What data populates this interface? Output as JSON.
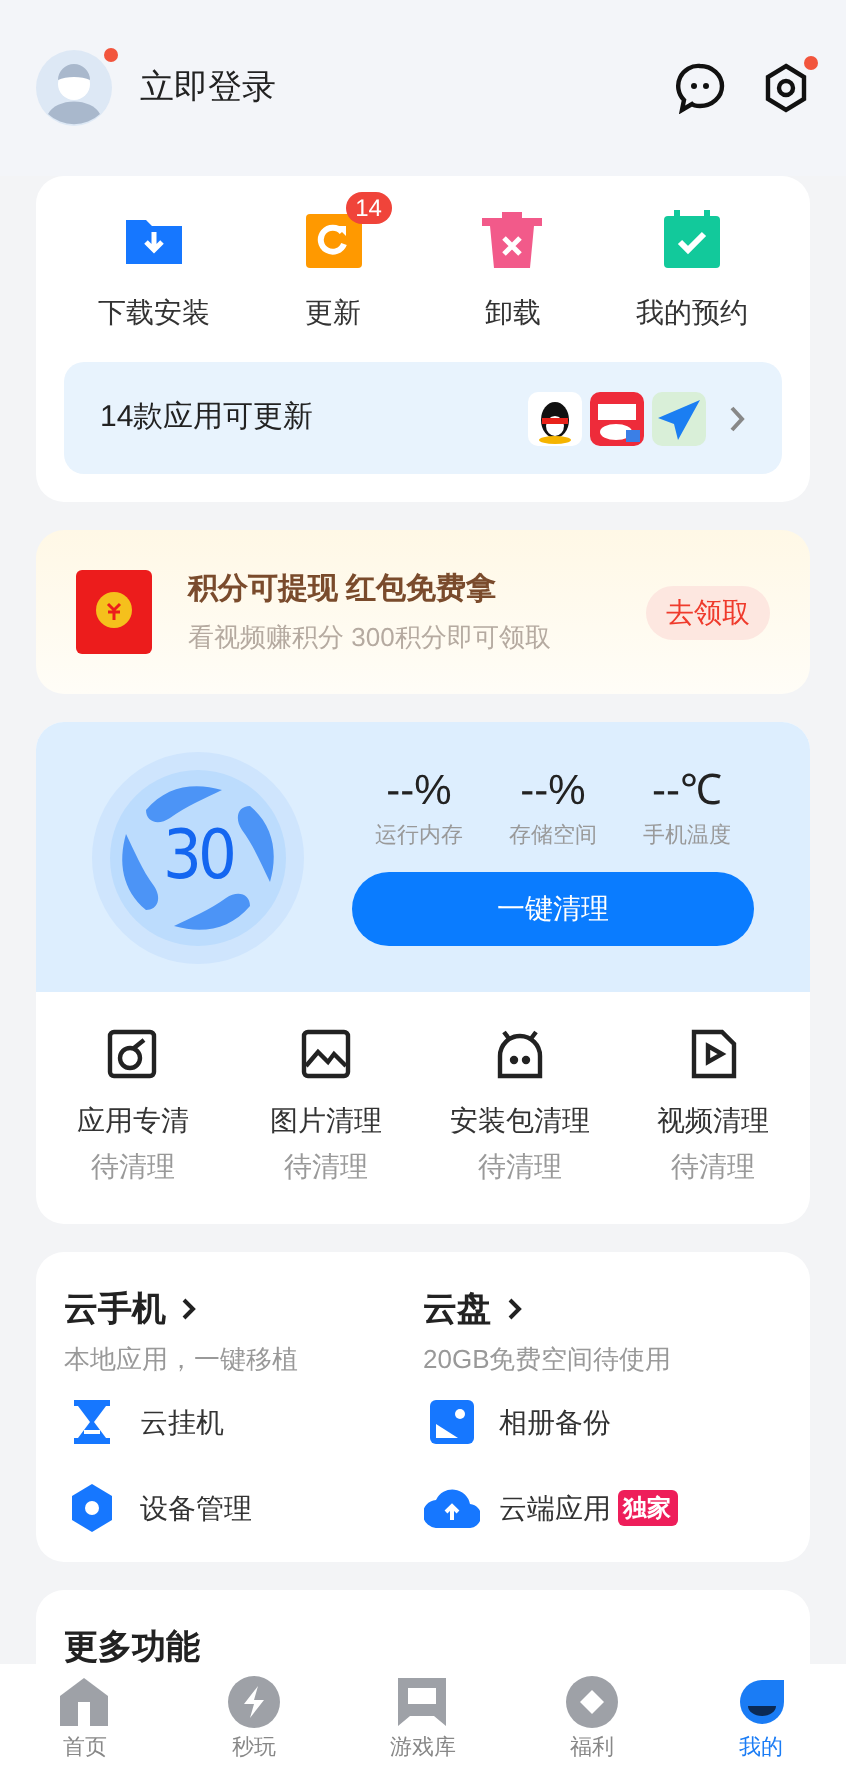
{
  "header": {
    "title": "立即登录",
    "avatar_badge": true,
    "settings_badge": true
  },
  "quick_actions": [
    {
      "label": "下载安装",
      "kind": "download"
    },
    {
      "label": "更新",
      "kind": "update",
      "badge": "14"
    },
    {
      "label": "卸载",
      "kind": "uninstall"
    },
    {
      "label": "我的预约",
      "kind": "booking"
    }
  ],
  "update_bar": {
    "text": "14款应用可更新"
  },
  "promo": {
    "title": "积分可提现 红包免费拿",
    "subtitle": "看视频赚积分 300积分即可领取",
    "button": "去领取"
  },
  "cleaner": {
    "score": "30",
    "stats": [
      {
        "value": "--%",
        "label": "运行内存"
      },
      {
        "value": "--%",
        "label": "存储空间"
      },
      {
        "value": "--℃",
        "label": "手机温度"
      }
    ],
    "button": "一键清理",
    "items": [
      {
        "kind": "app",
        "title": "应用专清",
        "status": "待清理"
      },
      {
        "kind": "image",
        "title": "图片清理",
        "status": "待清理"
      },
      {
        "kind": "package",
        "title": "安装包清理",
        "status": "待清理"
      },
      {
        "kind": "video",
        "title": "视频清理",
        "status": "待清理"
      }
    ]
  },
  "cloud": {
    "columns": [
      {
        "title": "云手机",
        "subtitle": "本地应用，一键移植",
        "items": [
          {
            "kind": "hourglass",
            "label": "云挂机"
          },
          {
            "kind": "device",
            "label": "设备管理"
          }
        ]
      },
      {
        "title": "云盘",
        "subtitle": "20GB免费空间待使用",
        "items": [
          {
            "kind": "album",
            "label": "相册备份"
          },
          {
            "kind": "upload",
            "label": "云端应用",
            "tag": "独家"
          }
        ]
      }
    ]
  },
  "more": {
    "title": "更多功能"
  },
  "nav": [
    {
      "label": "首页",
      "kind": "home",
      "selected": false
    },
    {
      "label": "秒玩",
      "kind": "bolt",
      "selected": false
    },
    {
      "label": "游戏库",
      "kind": "games",
      "selected": false
    },
    {
      "label": "福利",
      "kind": "gift",
      "selected": false
    },
    {
      "label": "我的",
      "kind": "me",
      "selected": true
    }
  ]
}
